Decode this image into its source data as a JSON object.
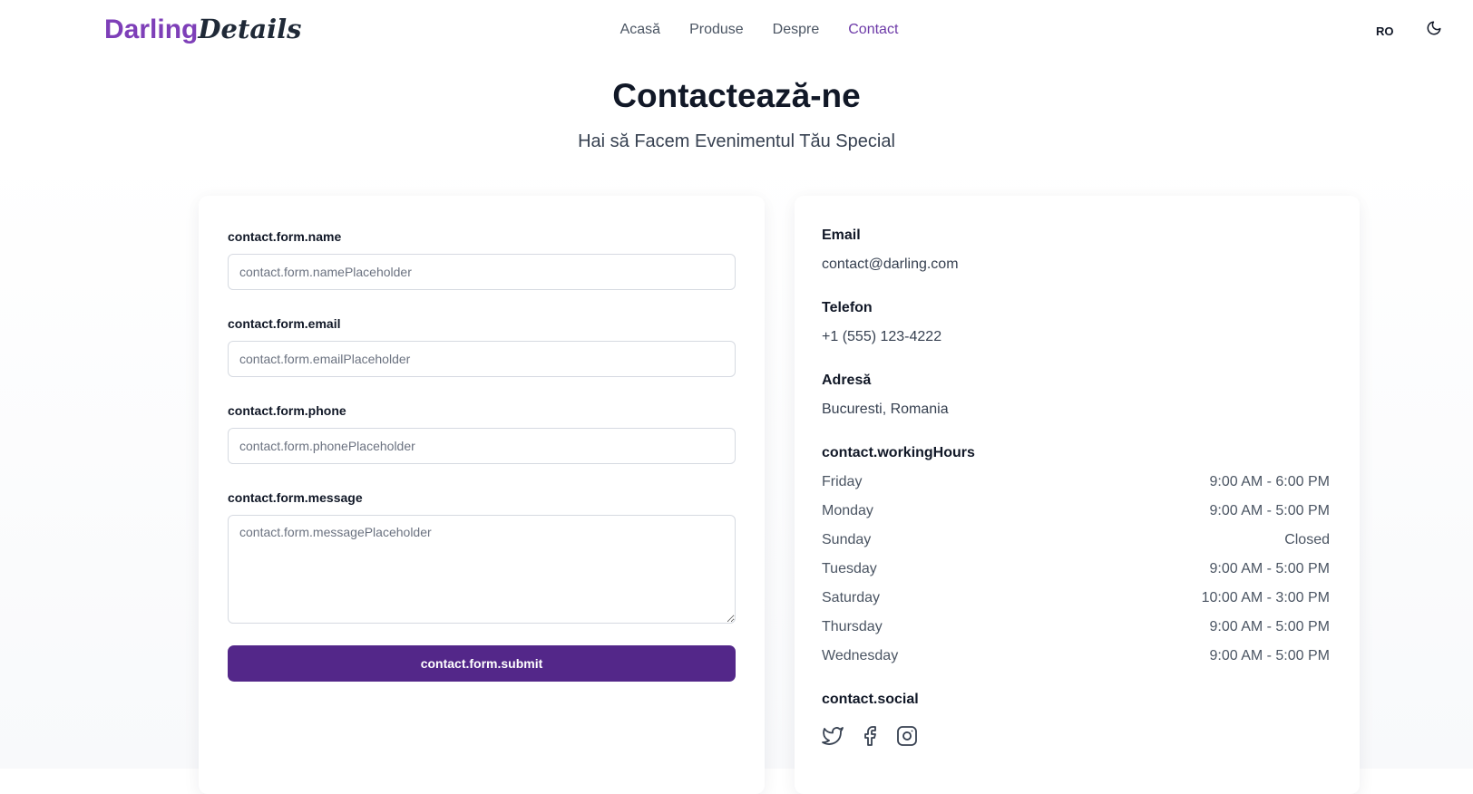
{
  "brand": {
    "part1": "Darling",
    "part2": "Details",
    "color_primary": "#7e3fb8"
  },
  "nav": {
    "items": [
      {
        "label": "Acasă"
      },
      {
        "label": "Produse"
      },
      {
        "label": "Despre"
      },
      {
        "label": "Contact",
        "active": true
      }
    ],
    "language": "RO",
    "theme_icon": "moon-icon"
  },
  "hero": {
    "title": "Contactează-ne",
    "subtitle": "Hai să Facem Evenimentul Tău Special"
  },
  "form": {
    "name_label": "contact.form.name",
    "name_placeholder": "contact.form.namePlaceholder",
    "email_label": "contact.form.email",
    "email_placeholder": "contact.form.emailPlaceholder",
    "phone_label": "contact.form.phone",
    "phone_placeholder": "contact.form.phonePlaceholder",
    "message_label": "contact.form.message",
    "message_placeholder": "contact.form.messagePlaceholder",
    "submit_label": "contact.form.submit",
    "submit_color": "#532789"
  },
  "info": {
    "email_label": "Email",
    "email_value": "contact@darling.com",
    "phone_label": "Telefon",
    "phone_value": "+1 (555) 123-4222",
    "address_label": "Adresă",
    "address_value": "Bucuresti, Romania",
    "hours_label": "contact.workingHours",
    "hours": [
      {
        "day": "Friday",
        "time": "9:00 AM - 6:00 PM"
      },
      {
        "day": "Monday",
        "time": "9:00 AM - 5:00 PM"
      },
      {
        "day": "Sunday",
        "time": "Closed"
      },
      {
        "day": "Tuesday",
        "time": "9:00 AM - 5:00 PM"
      },
      {
        "day": "Saturday",
        "time": "10:00 AM - 3:00 PM"
      },
      {
        "day": "Thursday",
        "time": "9:00 AM - 5:00 PM"
      },
      {
        "day": "Wednesday",
        "time": "9:00 AM - 5:00 PM"
      }
    ],
    "social_label": "contact.social",
    "social_icons": [
      "twitter-icon",
      "facebook-icon",
      "instagram-icon"
    ]
  }
}
